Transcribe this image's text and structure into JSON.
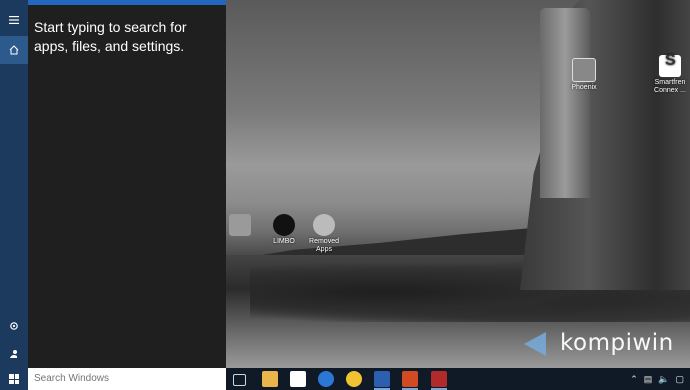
{
  "search_panel": {
    "prompt": "Start typing to search for apps, files, and settings."
  },
  "search_box": {
    "placeholder": "Search Windows"
  },
  "desktop_icons": [
    {
      "label": "Phoenix"
    },
    {
      "label": "Smartfren Connex ..."
    },
    {
      "label": "LIMBO"
    },
    {
      "label": "Removed Apps"
    }
  ],
  "watermark": {
    "brand": "kompiwin"
  },
  "nav_rail": {
    "icons": [
      "hamburger-menu-icon",
      "home-icon",
      "settings-icon",
      "feedback-icon"
    ]
  },
  "taskbar": {
    "pinned": [
      "task-view-icon",
      "file-explorer-icon",
      "store-icon",
      "edge-icon",
      "app-icon",
      "word-icon",
      "powerpoint-icon",
      "acrobat-icon"
    ],
    "tray_icons": [
      "chevron-up-icon",
      "network-icon",
      "volume-icon",
      "notification-icon"
    ]
  },
  "colors": {
    "accent": "#2266c0",
    "rail": "#1b3a5e",
    "panel": "#1f1f1f",
    "taskbar": "#101a27"
  }
}
